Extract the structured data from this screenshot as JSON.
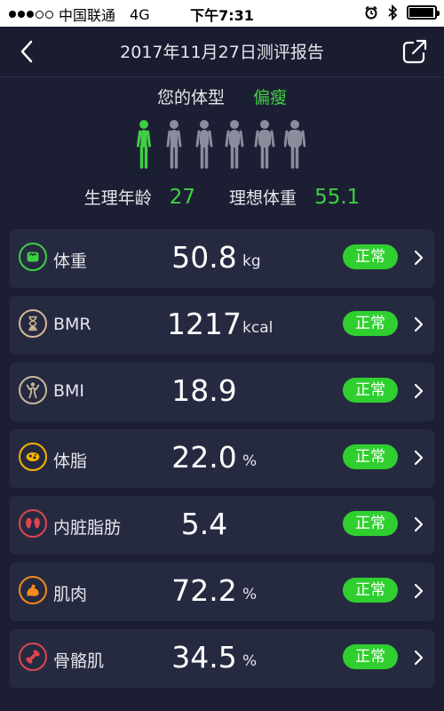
{
  "status_bar": {
    "carrier": "中国联通",
    "network": "4G",
    "time": "下午7:31",
    "signal_filled": 3,
    "signal_total": 5,
    "battery_level": 0.95
  },
  "nav": {
    "title": "2017年11月27日测评报告",
    "back_icon": "chevron-left-icon",
    "share_icon": "share-icon"
  },
  "body_type": {
    "label": "您的体型",
    "value": "偏瘦",
    "selected_index": 0,
    "figure_count": 6,
    "selected_color": "#3fcf43",
    "other_color": "#8a8d9c"
  },
  "summary": {
    "age_label": "生理年龄",
    "age_value": "27",
    "ideal_weight_label": "理想体重",
    "ideal_weight_value": "55.1"
  },
  "metrics": [
    {
      "name": "体重",
      "value": "50.8",
      "unit": "kg",
      "status": "正常",
      "icon": "scale-icon",
      "color": "#3fcf43"
    },
    {
      "name": "BMR",
      "value": "1217",
      "unit": "kcal",
      "status": "正常",
      "icon": "hourglass-icon",
      "color": "#d3b896"
    },
    {
      "name": "BMI",
      "value": "18.9",
      "unit": "",
      "status": "正常",
      "icon": "bodybuilder-icon",
      "color": "#c8b89a"
    },
    {
      "name": "体脂",
      "value": "22.0",
      "unit": "%",
      "status": "正常",
      "icon": "fat-icon",
      "color": "#f6b400"
    },
    {
      "name": "内脏脂肪",
      "value": "5.4",
      "unit": "",
      "status": "正常",
      "icon": "kidney-icon",
      "color": "#e0454f"
    },
    {
      "name": "肌肉",
      "value": "72.2",
      "unit": "%",
      "status": "正常",
      "icon": "flexed-arm-icon",
      "color": "#f28a1c"
    },
    {
      "name": "骨骼肌",
      "value": "34.5",
      "unit": "%",
      "status": "正常",
      "icon": "bone-icon",
      "color": "#e0454f"
    }
  ],
  "colors": {
    "background": "#1c1f33",
    "card": "#262a41",
    "accent_green": "#3fcf43",
    "badge_green": "#2fcf2f"
  }
}
